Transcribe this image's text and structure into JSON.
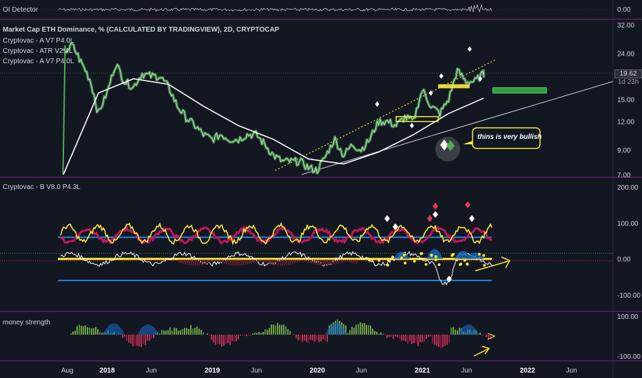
{
  "oi_panel": {
    "label": "OI Detector",
    "value": "0.00"
  },
  "main_panel": {
    "title": "Market Cap ETH Dominance, % (CALCULATED BY TRADINGVIEW), 2D, CRYPTOCAP",
    "indicators": [
      "Cryptovac - A V7 P4.0L",
      "Cryptovac - ATR V2.4L",
      "Cryptovac - A V7 P4.0L"
    ],
    "last_price": "19.62",
    "countdown": "1d 23h",
    "annotation": "thins is very bullish"
  },
  "osc_panel": {
    "label": "Cryptovac - B V8.0 P4.3L"
  },
  "money_panel": {
    "label": "money strength"
  },
  "colors": {
    "background": "#131722",
    "panel_border": "#7b2a8c",
    "price_line": "#f0f0f0",
    "ribbon": "#4caf50",
    "yellow": "#ffeb3b",
    "green_box": "#2e9d3f",
    "magenta": "#c2185b",
    "blue": "#1e88e5",
    "up_bar": "#8bc34a",
    "down_bar": "#e53958"
  },
  "chart_data": [
    {
      "type": "line",
      "panel": "OI Detector",
      "y_ticks": [
        "0.00"
      ]
    },
    {
      "type": "line",
      "panel": "main",
      "title": "Market Cap ETH Dominance, % (CALCULATED BY TRADINGVIEW), 2D, CRYPTOCAP",
      "scale": "log",
      "x_ticks": [
        "Aug",
        "2018",
        "Jun",
        "2019",
        "Jun",
        "2020",
        "Jun",
        "2021",
        "Jun",
        "2022",
        "Jun"
      ],
      "y_ticks": [
        "32.00",
        "24.00",
        "19.62",
        "15.00",
        "12.00",
        "9.00",
        "7.00"
      ],
      "series": [
        {
          "values": [
            [
              "2017-08",
              24.0
            ],
            [
              "2017-09",
              26.0
            ],
            [
              "2017-10",
              22.0
            ],
            [
              "2017-11",
              18.5
            ],
            [
              "2017-12",
              13.0
            ],
            [
              "2018-01",
              16.0
            ],
            [
              "2018-02",
              21.5
            ],
            [
              "2018-03",
              18.0
            ],
            [
              "2018-04",
              17.0
            ],
            [
              "2018-05",
              19.5
            ],
            [
              "2018-06",
              19.0
            ],
            [
              "2018-07",
              19.0
            ],
            [
              "2018-08",
              17.0
            ],
            [
              "2018-09",
              14.0
            ],
            [
              "2018-10",
              12.5
            ],
            [
              "2018-11",
              11.5
            ],
            [
              "2018-12",
              10.5
            ],
            [
              "2019-01",
              10.0
            ],
            [
              "2019-02",
              10.5
            ],
            [
              "2019-03",
              10.0
            ],
            [
              "2019-04",
              10.0
            ],
            [
              "2019-05",
              10.5
            ],
            [
              "2019-06",
              10.5
            ],
            [
              "2019-07",
              9.5
            ],
            [
              "2019-08",
              8.5
            ],
            [
              "2019-09",
              8.0
            ],
            [
              "2019-10",
              8.0
            ],
            [
              "2019-11",
              8.0
            ],
            [
              "2019-12",
              7.5
            ],
            [
              "2020-01",
              7.3
            ],
            [
              "2020-02",
              8.5
            ],
            [
              "2020-03",
              10.0
            ],
            [
              "2020-04",
              8.5
            ],
            [
              "2020-05",
              9.5
            ],
            [
              "2020-06",
              9.0
            ],
            [
              "2020-07",
              10.0
            ],
            [
              "2020-08",
              12.0
            ],
            [
              "2020-09",
              12.0
            ],
            [
              "2020-10",
              11.5
            ],
            [
              "2020-11",
              12.5
            ],
            [
              "2020-12",
              12.0
            ],
            [
              "2021-01",
              16.5
            ],
            [
              "2021-02",
              14.0
            ],
            [
              "2021-03",
              13.0
            ],
            [
              "2021-04",
              15.0
            ],
            [
              "2021-05",
              20.0
            ],
            [
              "2021-06",
              18.0
            ],
            [
              "2021-07",
              18.0
            ],
            [
              "2021-08",
              19.62
            ]
          ]
        },
        {
          "values": [
            [
              "2017-08",
              7.0
            ],
            [
              "2017-12",
              16.0
            ],
            [
              "2018-04",
              18.5
            ],
            [
              "2018-08",
              17.5
            ],
            [
              "2018-12",
              14.0
            ],
            [
              "2019-04",
              11.5
            ],
            [
              "2019-08",
              10.0
            ],
            [
              "2019-12",
              8.2
            ],
            [
              "2020-04",
              7.8
            ],
            [
              "2020-08",
              8.8
            ],
            [
              "2020-12",
              10.5
            ],
            [
              "2021-04",
              13.0
            ],
            [
              "2021-08",
              15.2
            ]
          ]
        }
      ]
    },
    {
      "type": "line",
      "panel": "Cryptovac - B V8.0 P4.3L",
      "y_ticks": [
        "200.00",
        "100.00",
        "0.00",
        "-100.00"
      ],
      "levels": [
        60,
        0,
        -60
      ]
    },
    {
      "type": "bar",
      "panel": "money strength",
      "y_ticks": [
        "100.00",
        "-100.00"
      ],
      "bars": 210
    }
  ]
}
